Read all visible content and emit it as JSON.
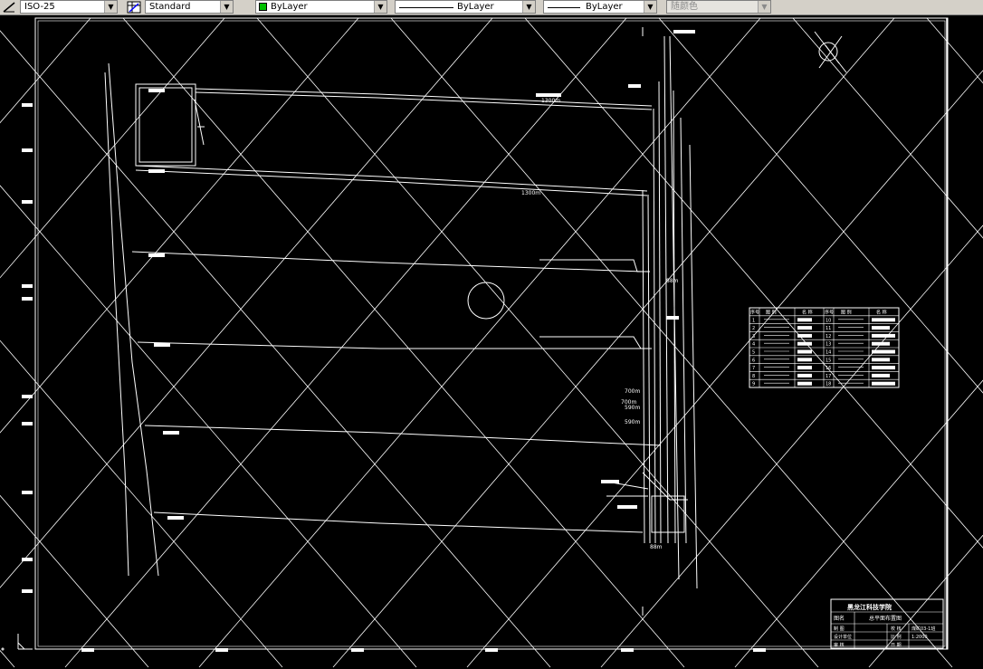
{
  "toolbar": {
    "dimstyle": "ISO-25",
    "tablestyle": "Standard",
    "layer_color": "ByLayer",
    "linetype": "ByLayer",
    "lineweight": "ByLayer",
    "plotstyle": "随颜色"
  },
  "drawing": {
    "title_block": {
      "school": "黑龙江科技学院",
      "drawing_name": "总平面布置图",
      "label_main": "图名",
      "rows": [
        {
          "k1": "制 图",
          "k2": "校 核",
          "v2": "煤矿03-1班"
        },
        {
          "k1": "设计单位",
          "k2": "比 例",
          "v2": "1:2000"
        },
        {
          "k1": "审 核",
          "k2": "日 期",
          "v2": ""
        }
      ]
    },
    "legend": {
      "headers": [
        "序号",
        "图 例",
        "名 称",
        "序号",
        "图 例",
        "名 称"
      ],
      "rows": [
        [
          "1",
          "10"
        ],
        [
          "2",
          "11"
        ],
        [
          "3",
          "12"
        ],
        [
          "4",
          "13"
        ],
        [
          "5",
          "14"
        ],
        [
          "6",
          "15"
        ],
        [
          "7",
          "16"
        ],
        [
          "8",
          "17"
        ],
        [
          "9",
          "18"
        ]
      ]
    },
    "dim_labels": [
      "1300m",
      "1300m",
      "700m",
      "700m",
      "590m",
      "590m",
      "88m",
      "88m"
    ]
  }
}
